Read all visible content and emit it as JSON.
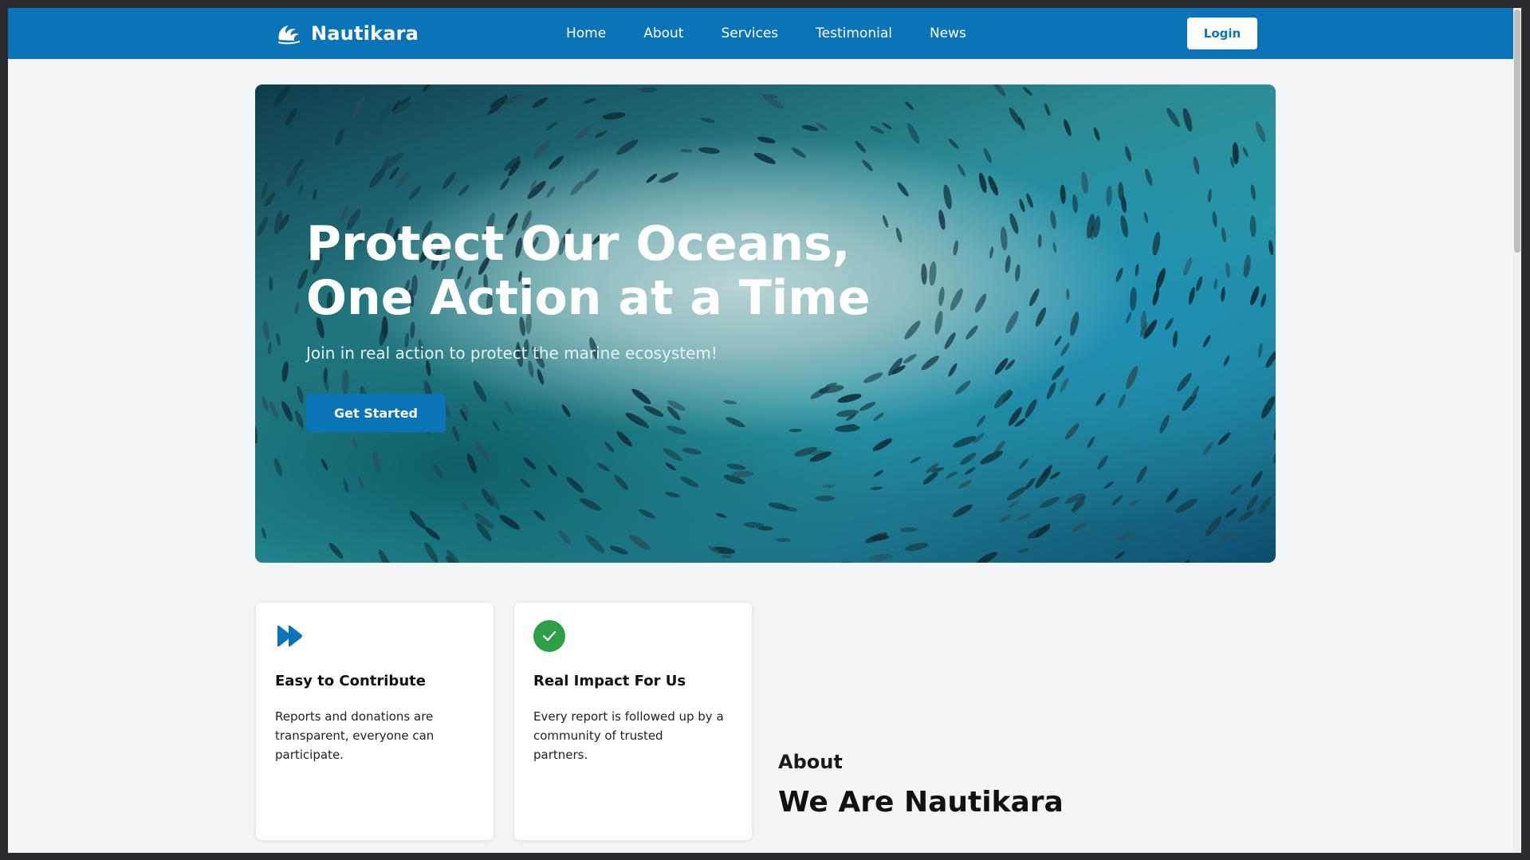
{
  "brand": {
    "name": "Nautikara",
    "logo_icon": "wave-icon"
  },
  "nav": {
    "links": [
      "Home",
      "About",
      "Services",
      "Testimonial",
      "News"
    ],
    "login_label": "Login"
  },
  "hero": {
    "title_line1": "Protect Our Oceans,",
    "title_line2": "One Action at a Time",
    "subtitle": "Join in real action to protect the marine ecosystem!",
    "cta_label": "Get Started"
  },
  "features": [
    {
      "icon": "fast-forward-icon",
      "title": "Easy to Contribute",
      "text_lines": [
        "Reports and donations are",
        "transparent, everyone can",
        "participate."
      ]
    },
    {
      "icon": "check-circle-icon",
      "title": "Real Impact For Us",
      "text_lines": [
        "Every report is followed up by a",
        "community of trusted",
        "partners."
      ]
    }
  ],
  "about": {
    "label": "About",
    "heading": "We Are Nautikara"
  },
  "colors": {
    "primary": "#0b73b7",
    "success": "#2e9e47",
    "page_bg": "#f4f5f6"
  }
}
